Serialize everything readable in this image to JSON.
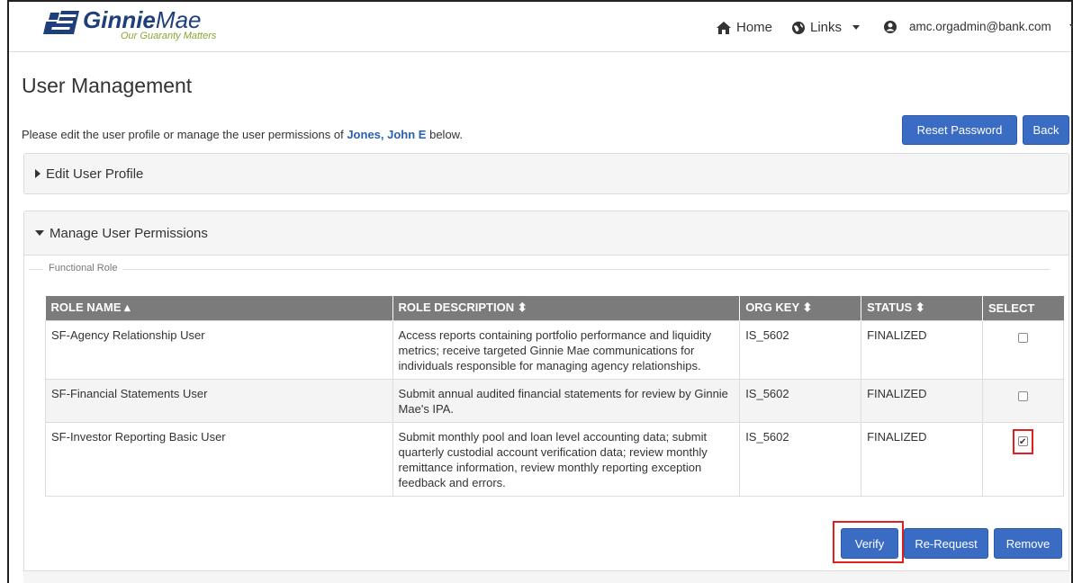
{
  "header": {
    "logo_name_bold": "Ginnie",
    "logo_name_thin": "Mae",
    "logo_tagline": "Our Guaranty Matters",
    "nav_home": "Home",
    "nav_links": "Links",
    "user_email": "amc.orgadmin@bank.com"
  },
  "page": {
    "title": "User Management",
    "intro_prefix": "Please edit the user profile or manage the user permissions of",
    "intro_user": "Jones, John E",
    "intro_suffix": "below."
  },
  "actions": {
    "reset_password": "Reset Password",
    "back": "Back"
  },
  "panels": {
    "edit_profile": "Edit User Profile",
    "manage_permissions": "Manage User Permissions",
    "functional_role_legend": "Functional Role"
  },
  "table": {
    "headers": [
      "ROLE NAME ▴",
      "ROLE DESCRIPTION ⬍",
      "ORG KEY ⬍",
      "STATUS ⬍",
      "SELECT"
    ],
    "rows": [
      {
        "name": "SF-Agency Relationship User",
        "description": "Access reports containing portfolio performance and liquidity metrics; receive targeted Ginnie Mae communications for individuals responsible for managing agency relationships.",
        "org_key": "IS_5602",
        "status": "FINALIZED",
        "selected": false
      },
      {
        "name": "SF-Financial Statements User",
        "description": "Submit annual audited financial statements for review by Ginnie Mae's IPA.",
        "org_key": "IS_5602",
        "status": "FINALIZED",
        "selected": false
      },
      {
        "name": "SF-Investor Reporting Basic User",
        "description": "Submit monthly pool and loan level accounting data; submit quarterly custodial account verification data; review monthly remittance information, review monthly reporting exception feedback and errors.",
        "org_key": "IS_5602",
        "status": "FINALIZED",
        "selected": true
      }
    ]
  },
  "buttons": {
    "verify": "Verify",
    "rerequest": "Re-Request",
    "remove": "Remove"
  },
  "colors": {
    "primary_button": "#3a6cc4",
    "highlight": "#e02020",
    "table_header": "#7b7b7b",
    "link_user": "#2a60b0"
  },
  "icons": {
    "home": "home-icon",
    "links": "globe-icon",
    "user": "user-circle-icon"
  }
}
